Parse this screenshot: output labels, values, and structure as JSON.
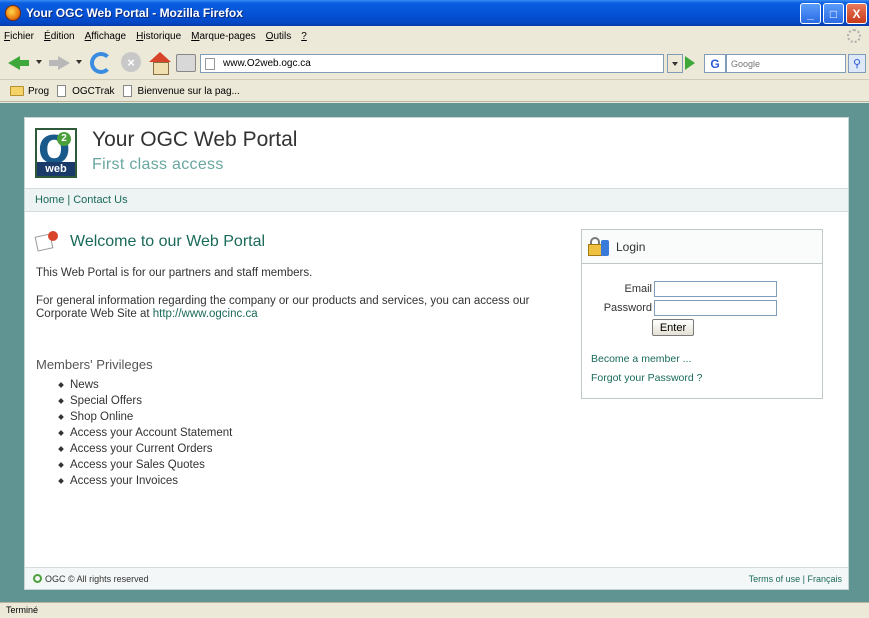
{
  "window": {
    "title": "Your OGC Web Portal - Mozilla Firefox",
    "controls": {
      "minimize": "_",
      "maximize": "□",
      "close": "X"
    }
  },
  "menu": {
    "items": [
      {
        "accel": "F",
        "rest": "ichier"
      },
      {
        "accel": "É",
        "rest": "dition"
      },
      {
        "accel": "A",
        "rest": "ffichage"
      },
      {
        "accel": "H",
        "rest": "istorique"
      },
      {
        "accel": "M",
        "rest": "arque-pages"
      },
      {
        "accel": "O",
        "rest": "utils"
      },
      {
        "accel": "?",
        "rest": ""
      }
    ]
  },
  "toolbar": {
    "url": "www.O2web.ogc.ca",
    "search_engine": "G",
    "search_placeholder": "Google",
    "icons": [
      "back-icon",
      "forward-icon",
      "reload-icon",
      "stop-icon",
      "home-icon",
      "print-icon"
    ]
  },
  "bookmarks": [
    {
      "label": "Prog",
      "icon": "folder-icon"
    },
    {
      "label": "OGCTrak",
      "icon": "page-icon"
    },
    {
      "label": "Bienvenue sur la pag...",
      "icon": "page-icon"
    }
  ],
  "portal": {
    "title": "Your OGC Web Portal",
    "subtitle": "First class access",
    "logo": {
      "letter": "O",
      "sup": "2",
      "badge": "web"
    },
    "nav": {
      "home": "Home",
      "separator": "|",
      "contact": "Contact Us"
    },
    "welcome": {
      "title": "Welcome to our Web Portal",
      "intro": "This Web Portal is for our partners and staff members.",
      "info": "For general information regarding the company or our products and services, you can access our Corporate Web Site at ",
      "link": "http://www.ogcinc.ca"
    },
    "privileges": {
      "title": "Members' Privileges",
      "items": [
        "News",
        "Special Offers",
        "Shop Online",
        "Access your Account Statement",
        "Access your Current Orders",
        "Access your Sales Quotes",
        "Access your Invoices"
      ]
    },
    "login": {
      "title": "Login",
      "email_label": "Email",
      "password_label": "Password",
      "email_value": "",
      "password_value": "",
      "enter": "Enter",
      "become_member": "Become a member ...",
      "forgot_password": "Forgot your Password ?"
    },
    "footer": {
      "copyright": "OGC © All rights reserved",
      "terms": "Terms of use",
      "separator": "|",
      "lang": "Français"
    }
  },
  "status": "Terminé",
  "colors": {
    "page_background": "#5f9493",
    "accent_text": "#1a6a5a",
    "subtitle": "#6aa6a0"
  }
}
